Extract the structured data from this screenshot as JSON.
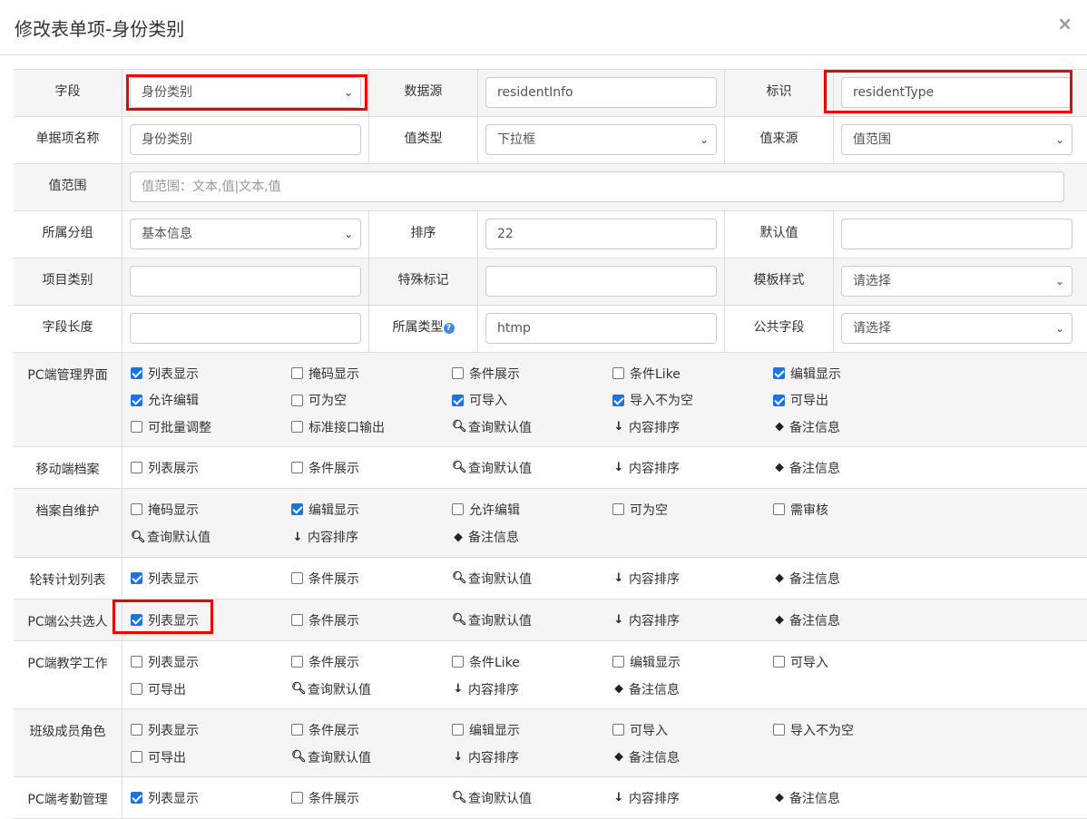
{
  "modal": {
    "title": "修改表单项-身份类别",
    "close": "×"
  },
  "fields": {
    "ziduan": {
      "label": "字段",
      "value": "身份类别"
    },
    "datasource": {
      "label": "数据源",
      "value": "residentInfo"
    },
    "biaoshi": {
      "label": "标识",
      "value": "residentType"
    },
    "danjuming": {
      "label": "单据项名称",
      "value": "身份类别"
    },
    "zhileixing": {
      "label": "值类型",
      "value": "下拉框"
    },
    "zhilaiyuan": {
      "label": "值来源",
      "value": "值范围"
    },
    "zhifanwei": {
      "label": "值范围",
      "placeholder": "值范围：文本,值|文本,值"
    },
    "suoshufenzu": {
      "label": "所属分组",
      "value": "基本信息"
    },
    "paixu": {
      "label": "排序",
      "value": "22"
    },
    "morenzhi": {
      "label": "默认值",
      "value": ""
    },
    "xiangmuleibie": {
      "label": "项目类别",
      "value": ""
    },
    "teshubiaoji": {
      "label": "特殊标记",
      "value": ""
    },
    "mobanyangshi": {
      "label": "模板样式",
      "value": "请选择"
    },
    "ziduanchangdu": {
      "label": "字段长度",
      "value": ""
    },
    "suoshuleixing": {
      "label": "所属类型",
      "value": "htmp"
    },
    "gonggongziduan": {
      "label": "公共字段",
      "value": "请选择"
    }
  },
  "sections": [
    {
      "label": "PC端管理界面",
      "items": [
        {
          "type": "cb",
          "label": "列表显示",
          "checked": true
        },
        {
          "type": "cb",
          "label": "掩码显示",
          "checked": false
        },
        {
          "type": "cb",
          "label": "条件展示",
          "checked": false
        },
        {
          "type": "cb",
          "label": "条件Like",
          "checked": false
        },
        {
          "type": "cb",
          "label": "编辑显示",
          "checked": true
        },
        {
          "type": "cb",
          "label": "允许编辑",
          "checked": true
        },
        {
          "type": "cb",
          "label": "可为空",
          "checked": false
        },
        {
          "type": "cb",
          "label": "可导入",
          "checked": true
        },
        {
          "type": "cb",
          "label": "导入不为空",
          "checked": true
        },
        {
          "type": "cb",
          "label": "可导出",
          "checked": true
        },
        {
          "type": "cb",
          "label": "可批量调整",
          "checked": false
        },
        {
          "type": "cb",
          "label": "标准接口输出",
          "checked": false
        },
        {
          "type": "icon",
          "icon": "search",
          "label": "查询默认值"
        },
        {
          "type": "icon",
          "icon": "sort",
          "label": "内容排序"
        },
        {
          "type": "icon",
          "icon": "tag",
          "label": "备注信息"
        }
      ]
    },
    {
      "label": "移动端档案",
      "items": [
        {
          "type": "cb",
          "label": "列表展示",
          "checked": false
        },
        {
          "type": "cb",
          "label": "条件展示",
          "checked": false
        },
        {
          "type": "icon",
          "icon": "search",
          "label": "查询默认值"
        },
        {
          "type": "icon",
          "icon": "sort",
          "label": "内容排序"
        },
        {
          "type": "icon",
          "icon": "tag",
          "label": "备注信息"
        }
      ]
    },
    {
      "label": "档案自维护",
      "items": [
        {
          "type": "cb",
          "label": "掩码显示",
          "checked": false
        },
        {
          "type": "cb",
          "label": "编辑显示",
          "checked": true
        },
        {
          "type": "cb",
          "label": "允许编辑",
          "checked": false
        },
        {
          "type": "cb",
          "label": "可为空",
          "checked": false
        },
        {
          "type": "cb",
          "label": "需审核",
          "checked": false
        },
        {
          "type": "icon",
          "icon": "search",
          "label": "查询默认值"
        },
        {
          "type": "icon",
          "icon": "sort",
          "label": "内容排序"
        },
        {
          "type": "icon",
          "icon": "tag",
          "label": "备注信息"
        }
      ]
    },
    {
      "label": "轮转计划列表",
      "items": [
        {
          "type": "cb",
          "label": "列表显示",
          "checked": true
        },
        {
          "type": "cb",
          "label": "条件展示",
          "checked": false
        },
        {
          "type": "icon",
          "icon": "search",
          "label": "查询默认值"
        },
        {
          "type": "icon",
          "icon": "sort",
          "label": "内容排序"
        },
        {
          "type": "icon",
          "icon": "tag",
          "label": "备注信息"
        }
      ]
    },
    {
      "label": "PC端公共选人",
      "items": [
        {
          "type": "cb",
          "label": "列表显示",
          "checked": true
        },
        {
          "type": "cb",
          "label": "条件展示",
          "checked": false
        },
        {
          "type": "icon",
          "icon": "search",
          "label": "查询默认值"
        },
        {
          "type": "icon",
          "icon": "sort",
          "label": "内容排序"
        },
        {
          "type": "icon",
          "icon": "tag",
          "label": "备注信息"
        }
      ]
    },
    {
      "label": "PC端教学工作",
      "items": [
        {
          "type": "cb",
          "label": "列表显示",
          "checked": false
        },
        {
          "type": "cb",
          "label": "条件展示",
          "checked": false
        },
        {
          "type": "cb",
          "label": "条件Like",
          "checked": false
        },
        {
          "type": "cb",
          "label": "编辑显示",
          "checked": false
        },
        {
          "type": "cb",
          "label": "可导入",
          "checked": false
        },
        {
          "type": "cb",
          "label": "可导出",
          "checked": false
        },
        {
          "type": "icon",
          "icon": "search",
          "label": "查询默认值"
        },
        {
          "type": "icon",
          "icon": "sort",
          "label": "内容排序"
        },
        {
          "type": "icon",
          "icon": "tag",
          "label": "备注信息"
        }
      ]
    },
    {
      "label": "班级成员角色",
      "items": [
        {
          "type": "cb",
          "label": "列表显示",
          "checked": false
        },
        {
          "type": "cb",
          "label": "条件展示",
          "checked": false
        },
        {
          "type": "cb",
          "label": "编辑显示",
          "checked": false
        },
        {
          "type": "cb",
          "label": "可导入",
          "checked": false
        },
        {
          "type": "cb",
          "label": "导入不为空",
          "checked": false
        },
        {
          "type": "cb",
          "label": "可导出",
          "checked": false
        },
        {
          "type": "icon",
          "icon": "search",
          "label": "查询默认值"
        },
        {
          "type": "icon",
          "icon": "sort",
          "label": "内容排序"
        },
        {
          "type": "icon",
          "icon": "tag",
          "label": "备注信息"
        }
      ]
    },
    {
      "label": "PC端考勤管理",
      "items": [
        {
          "type": "cb",
          "label": "列表显示",
          "checked": true
        },
        {
          "type": "cb",
          "label": "条件展示",
          "checked": false
        },
        {
          "type": "icon",
          "icon": "search",
          "label": "查询默认值"
        },
        {
          "type": "icon",
          "icon": "sort",
          "label": "内容排序"
        },
        {
          "type": "icon",
          "icon": "tag",
          "label": "备注信息"
        }
      ]
    }
  ],
  "icons": {
    "search": "🔍︎",
    "sort": "↓",
    "tag": "⬥",
    "select": "⌄",
    "help": "?"
  }
}
